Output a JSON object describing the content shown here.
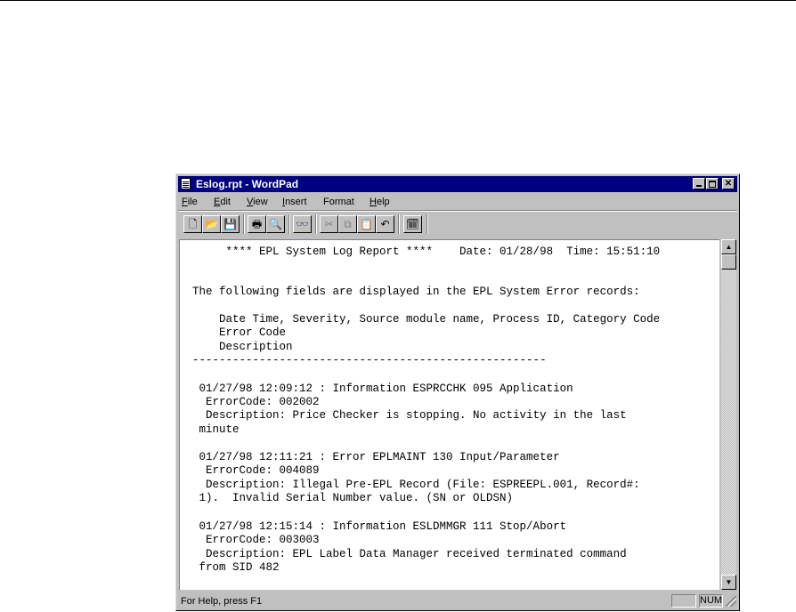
{
  "window": {
    "title": "Eslog.rpt - WordPad",
    "controls": {
      "minimize": "_",
      "maximize": "□",
      "close": "✕"
    }
  },
  "menu": [
    {
      "acc": "F",
      "rest": "ile"
    },
    {
      "acc": "E",
      "rest": "dit"
    },
    {
      "acc": "V",
      "rest": "iew"
    },
    {
      "acc": "I",
      "rest": "nsert"
    },
    {
      "acc": "F",
      "pre": "",
      "rest": "ormat",
      "under_index": 1
    },
    {
      "acc": "H",
      "rest": "elp"
    }
  ],
  "toolbar": {
    "buttons": [
      {
        "name": "new-icon",
        "glyph": "🗋"
      },
      {
        "name": "open-icon",
        "glyph": "📂"
      },
      {
        "name": "save-icon",
        "glyph": "💾"
      },
      {
        "name": "print-icon",
        "glyph": "🖶"
      },
      {
        "name": "print-preview-icon",
        "glyph": "🔍"
      },
      {
        "name": "find-icon",
        "glyph": "👓"
      },
      {
        "name": "cut-icon",
        "glyph": "✂"
      },
      {
        "name": "copy-icon",
        "glyph": "⧉"
      },
      {
        "name": "paste-icon",
        "glyph": "📋"
      },
      {
        "name": "undo-icon",
        "glyph": "↶"
      },
      {
        "name": "date-time-icon",
        "glyph": "🗓"
      }
    ]
  },
  "document": {
    "lines": [
      "     **** EPL System Log Report ****    Date: 01/28/98  Time: 15:51:10",
      "",
      "",
      "The following fields are displayed in the EPL System Error records:",
      "",
      "    Date Time, Severity, Source module name, Process ID, Category Code",
      "    Error Code",
      "    Description",
      "-----------------------------------------------------",
      "",
      "",
      " 01/27/98 12:09:12 : Information ESPRCCHK 095 Application",
      "  ErrorCode: 002002",
      "  Description: Price Checker is stopping. No activity in the last",
      " minute",
      "",
      " 01/27/98 12:11:21 : Error EPLMAINT 130 Input/Parameter",
      "  ErrorCode: 004089",
      "  Description: Illegal Pre-EPL Record (File: ESPREEPL.001, Record#:",
      " 1).  Invalid Serial Number value. (SN or OLDSN)",
      "",
      " 01/27/98 12:15:14 : Information ESLDMMGR 111 Stop/Abort",
      "  ErrorCode: 003003",
      "  Description: EPL Label Data Manager received terminated command",
      " from SID 482"
    ]
  },
  "statusbar": {
    "help_text": "For Help, press F1",
    "num_indicator": "NUM"
  }
}
